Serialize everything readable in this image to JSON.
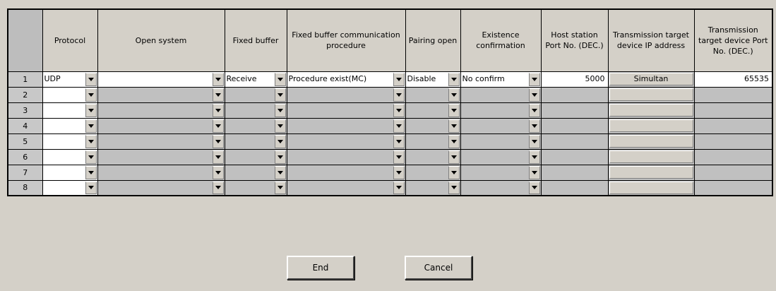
{
  "headers": {
    "num": "",
    "protocol": "Protocol",
    "open_system": "Open system",
    "fixed_buffer": "Fixed buffer",
    "fb_procedure": "Fixed buffer communication procedure",
    "pairing_open": "Pairing open",
    "existence": "Existence confirmation",
    "host_port": "Host station Port No. (DEC.)",
    "target_ip": "Transmission target device IP address",
    "target_port": "Transmission target device Port No. (DEC.)"
  },
  "rows": [
    {
      "num": "1",
      "protocol": "UDP",
      "open_system": "",
      "fixed_buffer": "Receive",
      "fb_procedure": "Procedure exist(MC)",
      "pairing_open": "Disable",
      "existence": "No confirm",
      "host_port": "5000",
      "target_ip": "Simultan",
      "target_port": "65535"
    },
    {
      "num": "2",
      "protocol": "",
      "open_system": "",
      "fixed_buffer": "",
      "fb_procedure": "",
      "pairing_open": "",
      "existence": "",
      "host_port": "",
      "target_ip": "",
      "target_port": ""
    },
    {
      "num": "3",
      "protocol": "",
      "open_system": "",
      "fixed_buffer": "",
      "fb_procedure": "",
      "pairing_open": "",
      "existence": "",
      "host_port": "",
      "target_ip": "",
      "target_port": ""
    },
    {
      "num": "4",
      "protocol": "",
      "open_system": "",
      "fixed_buffer": "",
      "fb_procedure": "",
      "pairing_open": "",
      "existence": "",
      "host_port": "",
      "target_ip": "",
      "target_port": ""
    },
    {
      "num": "5",
      "protocol": "",
      "open_system": "",
      "fixed_buffer": "",
      "fb_procedure": "",
      "pairing_open": "",
      "existence": "",
      "host_port": "",
      "target_ip": "",
      "target_port": ""
    },
    {
      "num": "6",
      "protocol": "",
      "open_system": "",
      "fixed_buffer": "",
      "fb_procedure": "",
      "pairing_open": "",
      "existence": "",
      "host_port": "",
      "target_ip": "",
      "target_port": ""
    },
    {
      "num": "7",
      "protocol": "",
      "open_system": "",
      "fixed_buffer": "",
      "fb_procedure": "",
      "pairing_open": "",
      "existence": "",
      "host_port": "",
      "target_ip": "",
      "target_port": ""
    },
    {
      "num": "8",
      "protocol": "",
      "open_system": "",
      "fixed_buffer": "",
      "fb_procedure": "",
      "pairing_open": "",
      "existence": "",
      "host_port": "",
      "target_ip": "",
      "target_port": ""
    }
  ],
  "buttons": {
    "end": "End",
    "cancel": "Cancel"
  },
  "icons": {
    "dropdown": "chevron-down-icon"
  },
  "colors": {
    "window_bg": "#d4d0c8",
    "cell_gray": "#c0c0c0",
    "cell_white": "#ffffff"
  }
}
